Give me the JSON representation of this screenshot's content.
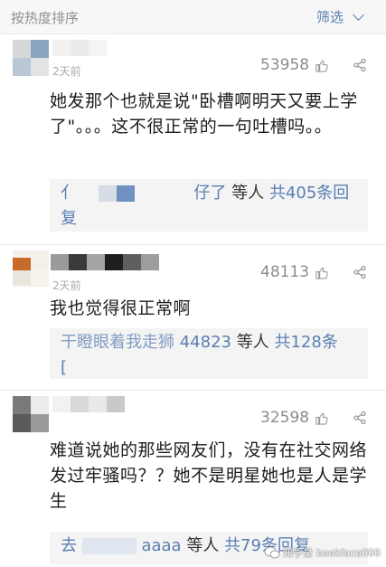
{
  "header": {
    "sort_label": "按热度排序",
    "filter_label": "筛选"
  },
  "comments": [
    {
      "time": "2天前",
      "likes": "53958",
      "text": "她发那个也就是说\"卧槽啊明天又要上学了\"。。。这不很正常的一句吐槽吗。。",
      "reply_prefix": "亻",
      "reply_tail": "仔了",
      "reply_count": "等人",
      "reply_total": "共405条回复"
    },
    {
      "time": "2天前",
      "likes": "48113",
      "text": "我也觉得很正常啊",
      "reply_prefix": "干瞪眼着我走狮",
      "reply_num": "44823",
      "reply_count": "等人",
      "reply_total": "共128条",
      "reply_line2": "["
    },
    {
      "time": "",
      "likes": "32598",
      "text": "难道说她的那些网友们，没有在社交网络发过牢骚吗？？她不是明星她也是人是学生",
      "reply_prefix": "去",
      "reply_mid": "aaaa",
      "reply_count": "等人",
      "reply_total": "共79条回复"
    }
  ],
  "watermark": "知乎录 bookface000",
  "colors": {
    "link_blue": "#5a7fb3",
    "gray_text": "#8c8c8c"
  }
}
